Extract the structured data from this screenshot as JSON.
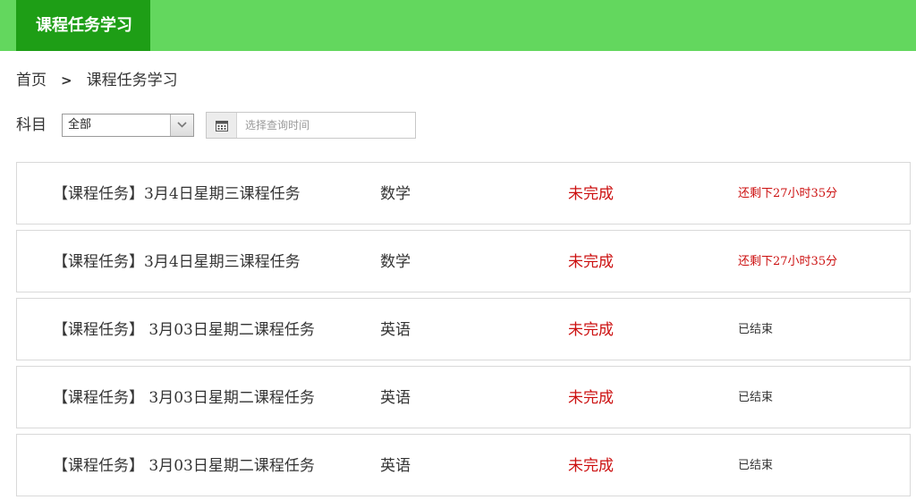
{
  "header": {
    "tab_label": "课程任务学习"
  },
  "breadcrumb": {
    "home": "首页",
    "separator": ">",
    "current": "课程任务学习"
  },
  "filters": {
    "subject_label": "科目",
    "subject_selected": "全部",
    "date_placeholder": "选择查询时间"
  },
  "tasks": [
    {
      "title": "【课程任务】3月4日星期三课程任务",
      "subject": "数学",
      "status": "未完成",
      "remaining": "还剩下27小时35分"
    },
    {
      "title": "【课程任务】3月4日星期三课程任务",
      "subject": "数学",
      "status": "未完成",
      "remaining": "还剩下27小时35分"
    },
    {
      "title": "【课程任务】 3月03日星期二课程任务",
      "subject": "英语",
      "status": "未完成",
      "remaining": "已结束"
    },
    {
      "title": "【课程任务】 3月03日星期二课程任务",
      "subject": "英语",
      "status": "未完成",
      "remaining": "已结束"
    },
    {
      "title": "【课程任务】 3月03日星期二课程任务",
      "subject": "英语",
      "status": "未完成",
      "remaining": "已结束"
    }
  ],
  "colors": {
    "topbar": "#63d75e",
    "active_tab": "#1e9e16",
    "status_red": "#cc1111"
  },
  "icons": {
    "select_arrow": "chevron-down-icon",
    "date": "calendar-icon"
  }
}
